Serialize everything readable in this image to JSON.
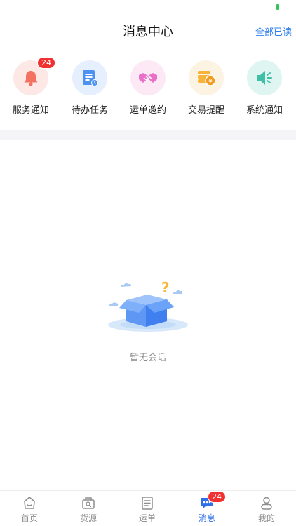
{
  "header": {
    "title": "消息中心",
    "mark_all_read": "全部已读"
  },
  "categories": [
    {
      "label": "服务通知",
      "icon": "bell-icon",
      "badge": "24",
      "bg": "#fde8e6",
      "color": "#f47060"
    },
    {
      "label": "待办任务",
      "icon": "task-list-icon",
      "badge": "",
      "bg": "#e5effd",
      "color": "#4d92f3"
    },
    {
      "label": "运单邀约",
      "icon": "handshake-icon",
      "badge": "",
      "bg": "#fce9f5",
      "color": "#ea6fc8"
    },
    {
      "label": "交易提醒",
      "icon": "coins-icon",
      "badge": "",
      "bg": "#fdf3e3",
      "color": "#f7b33a"
    },
    {
      "label": "系统通知",
      "icon": "speaker-icon",
      "badge": "",
      "bg": "#dff5f1",
      "color": "#3fbfa5"
    }
  ],
  "empty_state": {
    "text": "暂无会话",
    "icon": "empty-box-icon"
  },
  "tabbar": {
    "tabs": [
      {
        "label": "首页",
        "icon": "home-icon",
        "active": false
      },
      {
        "label": "货源",
        "icon": "cargo-search-icon",
        "active": false
      },
      {
        "label": "运单",
        "icon": "waybill-icon",
        "active": false
      },
      {
        "label": "消息",
        "icon": "chat-icon",
        "active": true,
        "badge": "24"
      },
      {
        "label": "我的",
        "icon": "profile-icon",
        "active": false
      }
    ]
  },
  "colors": {
    "accent": "#2f6fe8",
    "badge": "#f23030"
  }
}
